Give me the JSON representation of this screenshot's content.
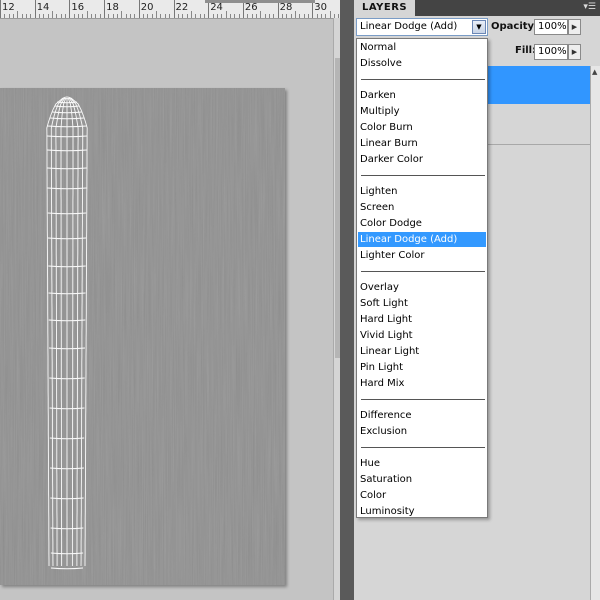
{
  "ruler": {
    "labels": [
      "12",
      "14",
      "16",
      "18",
      "20",
      "22",
      "24",
      "26",
      "28",
      "30"
    ]
  },
  "layers_panel": {
    "tab_label": "LAYERS",
    "menu_icon": "panel-menu-icon",
    "blend_mode": "Linear Dodge (Add)",
    "opacity_label": "Opacity:",
    "opacity_value": "100%",
    "fill_label": "Fill:",
    "fill_value": "100%"
  },
  "blend_menu": {
    "selected": "Linear Dodge (Add)",
    "groups": [
      [
        "Normal",
        "Dissolve"
      ],
      [
        "Darken",
        "Multiply",
        "Color Burn",
        "Linear Burn",
        "Darker Color"
      ],
      [
        "Lighten",
        "Screen",
        "Color Dodge",
        "Linear Dodge (Add)",
        "Lighter Color"
      ],
      [
        "Overlay",
        "Soft Light",
        "Hard Light",
        "Vivid Light",
        "Linear Light",
        "Pin Light",
        "Hard Mix"
      ],
      [
        "Difference",
        "Exclusion"
      ],
      [
        "Hue",
        "Saturation",
        "Color",
        "Luminosity"
      ]
    ]
  },
  "colors": {
    "selection": "#3399ff",
    "layer_selected": "#3196ff",
    "canvas": "#8a8a8a"
  }
}
